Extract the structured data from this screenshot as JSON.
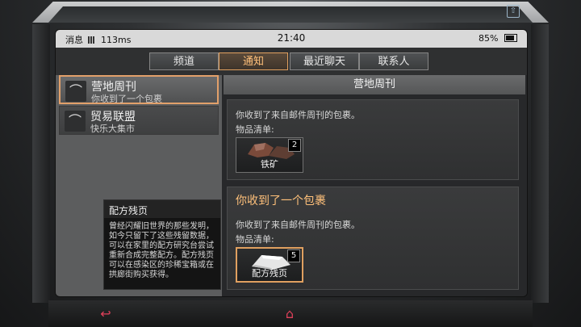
{
  "status": {
    "left_label": "消息",
    "ping": "113ms",
    "time": "21:40",
    "battery": "85%"
  },
  "tabs": [
    {
      "label": "频道",
      "active": false
    },
    {
      "label": "通知",
      "active": true
    },
    {
      "label": "最近聊天",
      "active": false
    },
    {
      "label": "联系人",
      "active": false
    }
  ],
  "list": [
    {
      "title": "营地周刊",
      "subtitle": "你收到了一个包裹",
      "icon": "satellite-dish-icon",
      "selected": true
    },
    {
      "title": "贸易联盟",
      "subtitle": "快乐大集市",
      "icon": "satellite-dish-icon",
      "selected": false
    }
  ],
  "pane": {
    "title": "营地周刊",
    "cards": [
      {
        "header": "",
        "line1": "你收到了来自邮件周刊的包裹。",
        "line2": "物品清单:",
        "item": {
          "name": "铁矿",
          "count": "2",
          "icon": "iron-ore-icon"
        }
      },
      {
        "header": "你收到了一个包裹",
        "line1": "你收到了来自邮件周刊的包裹。",
        "line2": "物品清单:",
        "item": {
          "name": "配方残页",
          "count": "5",
          "icon": "recipe-page-icon"
        }
      }
    ]
  },
  "tooltip": {
    "title": "配方残页",
    "body": "曾经闪耀旧世界的那些发明，如今只留下了这些残留数据，可以在家里的配方研究台尝试重新合成完整配方。配方残页可以在感染区的珍稀宝箱或在拱廊街购买获得。"
  },
  "colors": {
    "accent": "#e0a060",
    "nav_icon": "#e0405a"
  },
  "nav": {
    "back_icon": "back-arrow-icon",
    "home_icon": "home-icon"
  }
}
